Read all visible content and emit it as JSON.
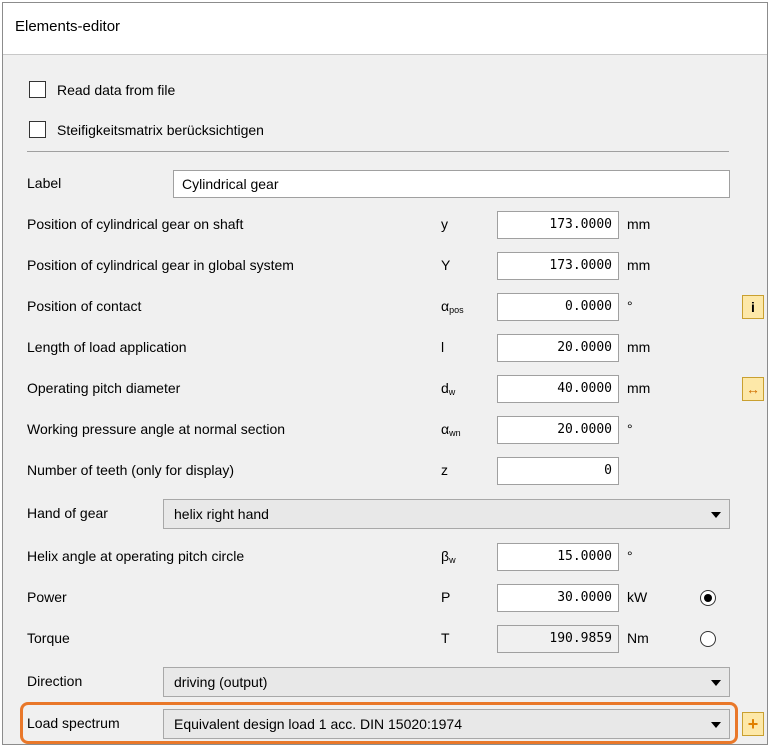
{
  "window": {
    "title": "Elements-editor"
  },
  "options": {
    "read_file": {
      "label": "Read data from file",
      "checked": false
    },
    "stiffness": {
      "label": "Steifigkeitsmatrix berücksichtigen",
      "checked": false
    }
  },
  "label_row": {
    "label": "Label",
    "value": "Cylindrical gear"
  },
  "rows": [
    {
      "label": "Position of cylindrical gear on shaft",
      "symbol": "y",
      "sub": "",
      "value": "173.0000",
      "unit": "mm"
    },
    {
      "label": "Position of cylindrical gear in global system",
      "symbol": "Y",
      "sub": "",
      "value": "173.0000",
      "unit": "mm"
    },
    {
      "label": "Position of contact",
      "symbol": "α",
      "sub": "pos",
      "value": "0.0000",
      "unit": "°"
    },
    {
      "label": "Length of load application",
      "symbol": "l",
      "sub": "",
      "value": "20.0000",
      "unit": "mm"
    },
    {
      "label": "Operating pitch diameter",
      "symbol": "d",
      "sub": "w",
      "value": "40.0000",
      "unit": "mm"
    },
    {
      "label": "Working pressure angle at normal section",
      "symbol": "α",
      "sub": "wn",
      "value": "20.0000",
      "unit": "°"
    },
    {
      "label": "Number of teeth (only for display)",
      "symbol": "z",
      "sub": "",
      "value": "0",
      "unit": ""
    }
  ],
  "hand": {
    "label": "Hand of gear",
    "value": "helix right hand"
  },
  "helix": {
    "label": "Helix angle at operating pitch circle",
    "symbol": "β",
    "sub": "w",
    "value": "15.0000",
    "unit": "°"
  },
  "power": {
    "label": "Power",
    "symbol": "P",
    "value": "30.0000",
    "unit": "kW",
    "selected": true
  },
  "torque": {
    "label": "Torque",
    "symbol": "T",
    "value": "190.9859",
    "unit": "Nm",
    "selected": false
  },
  "direction": {
    "label": "Direction",
    "value": "driving (output)"
  },
  "load_spectrum": {
    "label": "Load spectrum",
    "value": "Equivalent design load 1 acc. DIN 15020:1974"
  },
  "side_buttons": {
    "info": "i",
    "swap": "↔",
    "add": "+"
  },
  "colors": {
    "highlight": "#e9782a",
    "button_bg": "#fde8a8"
  }
}
